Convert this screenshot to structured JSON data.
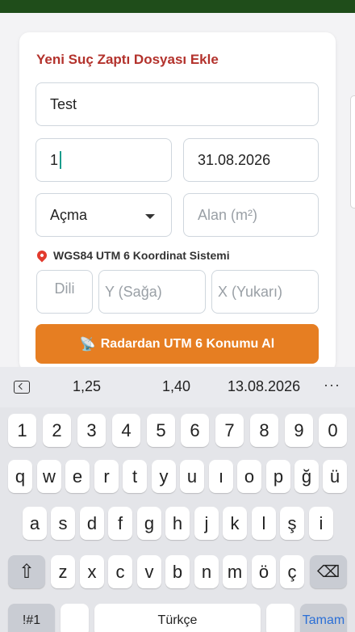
{
  "form": {
    "title": "Yeni Suç Zaptı Dosyası Ekle",
    "name_value": "Test",
    "number_value": "1",
    "date_value": "31.08.2026",
    "type_select_value": "Açma",
    "area_placeholder": "Alan (m²)",
    "coord_system_label": "WGS84 UTM 6 Koordinat Sistemi",
    "dili_placeholder": "Dili",
    "y_placeholder": "Y (Sağa)",
    "x_placeholder": "X (Yukarı)",
    "radar_button_label": "Radardan UTM 6 Konumu Al",
    "radar_icon": "📡"
  },
  "keyboard": {
    "suggestions": [
      "1,25",
      "1,40",
      "13.08.2026"
    ],
    "more_icon": "···",
    "row_numbers": [
      "1",
      "2",
      "3",
      "4",
      "5",
      "6",
      "7",
      "8",
      "9",
      "0"
    ],
    "row1": [
      "q",
      "w",
      "e",
      "r",
      "t",
      "y",
      "u",
      "ı",
      "o",
      "p",
      "ğ",
      "ü"
    ],
    "row2": [
      "a",
      "s",
      "d",
      "f",
      "g",
      "h",
      "j",
      "k",
      "l",
      "ş",
      "i"
    ],
    "row3": [
      "z",
      "x",
      "c",
      "v",
      "b",
      "n",
      "m",
      "ö",
      "ç"
    ],
    "shift_icon": "⇧",
    "backspace_icon": "⌫",
    "symbols_label": "!#1",
    "space_label": "Türkçe",
    "done_label": "Tamam"
  },
  "icons": {
    "pin": "location-pin-icon",
    "back": "keyboard-back-icon",
    "more": "more-horizontal-icon"
  },
  "colors": {
    "accent_red": "#b3322c",
    "radar_orange": "#e67e22",
    "top_bar_green": "#1f4d1a",
    "done_blue": "#2b6fd6"
  }
}
